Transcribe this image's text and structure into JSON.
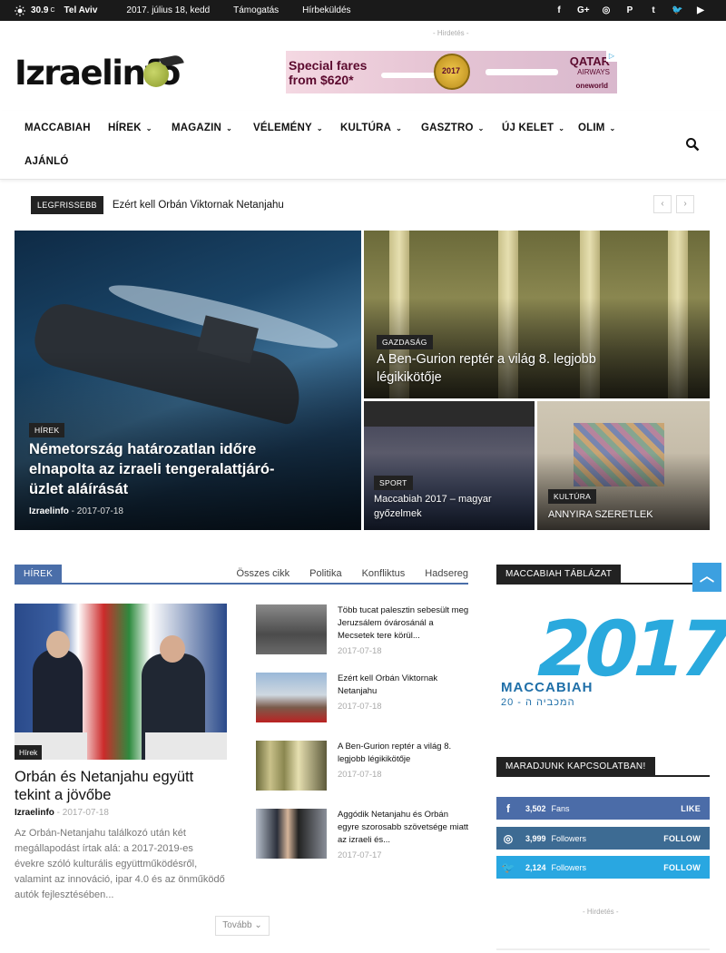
{
  "topbar": {
    "temperature": "30.9",
    "temp_unit": "C",
    "city": "Tel Aviv",
    "date": "2017. július 18, kedd",
    "links": [
      "Támogatás",
      "Hírbeküldés"
    ],
    "social_icons": [
      {
        "name": "facebook-icon",
        "glyph": "f"
      },
      {
        "name": "googleplus-icon",
        "glyph": "G+"
      },
      {
        "name": "instagram-icon",
        "glyph": "◎"
      },
      {
        "name": "pinterest-icon",
        "glyph": "P"
      },
      {
        "name": "tumblr-icon",
        "glyph": "t"
      },
      {
        "name": "twitter-icon",
        "glyph": "🐦"
      },
      {
        "name": "youtube-icon",
        "glyph": "▶"
      }
    ]
  },
  "ad_label": "- Hirdetés -",
  "sidebar_ad_label": "- Hirdetés -",
  "logo": {
    "text": "Izraelinfo"
  },
  "banner": {
    "headline": "Special fares from $620*",
    "badge": "2017",
    "airline": "QATAR",
    "airline_sub": "AIRWAYS",
    "alliance": "oneworld"
  },
  "nav": {
    "items": [
      {
        "label": "MACCABIAH",
        "chevron": false
      },
      {
        "label": "HÍREK",
        "chevron": true
      },
      {
        "label": "MAGAZIN",
        "chevron": true
      },
      {
        "label": "VÉLEMÉNY",
        "chevron": true
      },
      {
        "label": "KULTÚRA",
        "chevron": true
      },
      {
        "label": "GASZTRO",
        "chevron": true
      },
      {
        "label": "ÚJ KELET",
        "chevron": true
      },
      {
        "label": "OLIM",
        "chevron": true
      },
      {
        "label": "AJÁNLÓ",
        "chevron": false
      }
    ]
  },
  "ticker": {
    "tag": "LEGFRISSEBB",
    "headline": "Ezért kell Orbán Viktornak Netanjahu"
  },
  "hero": {
    "main": {
      "category": "HÍREK",
      "title": "Németország határozatlan időre elnapolta az izraeli tengeralattjáró-üzlet aláírását",
      "author": "Izraelinfo",
      "date": "2017-07-18"
    },
    "top_right": {
      "category": "GAZDASÁG",
      "title": "A Ben-Gurion reptér a világ 8. legjobb légikikötője"
    },
    "bottom_left": {
      "category": "SPORT",
      "title": "Maccabiah 2017 – magyar győzelmek"
    },
    "bottom_right": {
      "category": "KULTÚRA",
      "title": "ANNYIRA SZERETLEK"
    }
  },
  "news_section": {
    "label": "HÍREK",
    "filters": [
      "Összes cikk",
      "Politika",
      "Konfliktus",
      "Hadsereg"
    ],
    "featured": {
      "category": "Hírek",
      "title": "Orbán és Netanjahu együtt tekint a jövőbe",
      "author": "Izraelinfo",
      "date": "2017-07-18",
      "excerpt": "Az Orbán-Netanjahu találkozó után két megállapodást írtak alá: a 2017-2019-es évekre szóló kulturális együttműködésről, valamint az innováció, ipar 4.0 és az önműködő autók fejlesztésében..."
    },
    "list": [
      {
        "title": "Több tucat palesztin sebesült meg Jeruzsálem óvárosánál a Mecsetek tere körül...",
        "date": "2017-07-18"
      },
      {
        "title": "Ezért kell Orbán Viktornak Netanjahu",
        "date": "2017-07-18"
      },
      {
        "title": "A Ben-Gurion reptér a világ 8. legjobb légikikötője",
        "date": "2017-07-18"
      },
      {
        "title": "Aggódik Netanjahu és Orbán egyre szorosabb szövetsége miatt az izraeli és...",
        "date": "2017-07-17"
      }
    ],
    "more_label": "Tovább"
  },
  "sidebar": {
    "maccabiah_label": "MACCABIAH TÁBLÁZAT",
    "maccabiah_logo": {
      "year": "2017",
      "word": "MACCABIAH",
      "hebrew": "20 - המכביה ה"
    },
    "connect_label": "MARADJUNK KAPCSOLATBAN!",
    "social": [
      {
        "icon": "f",
        "count": "3,502",
        "unit": "Fans",
        "action": "LIKE"
      },
      {
        "icon": "◎",
        "count": "3,999",
        "unit": "Followers",
        "action": "FOLLOW"
      },
      {
        "icon": "🐦",
        "count": "2,124",
        "unit": "Followers",
        "action": "FOLLOW"
      }
    ]
  },
  "colors": {
    "accent": "#4a6ea9",
    "facebook": "#4b6ca8",
    "instagram": "#3d6b93",
    "twitter": "#29a7e1",
    "scroll_top": "#3ca0e0"
  }
}
